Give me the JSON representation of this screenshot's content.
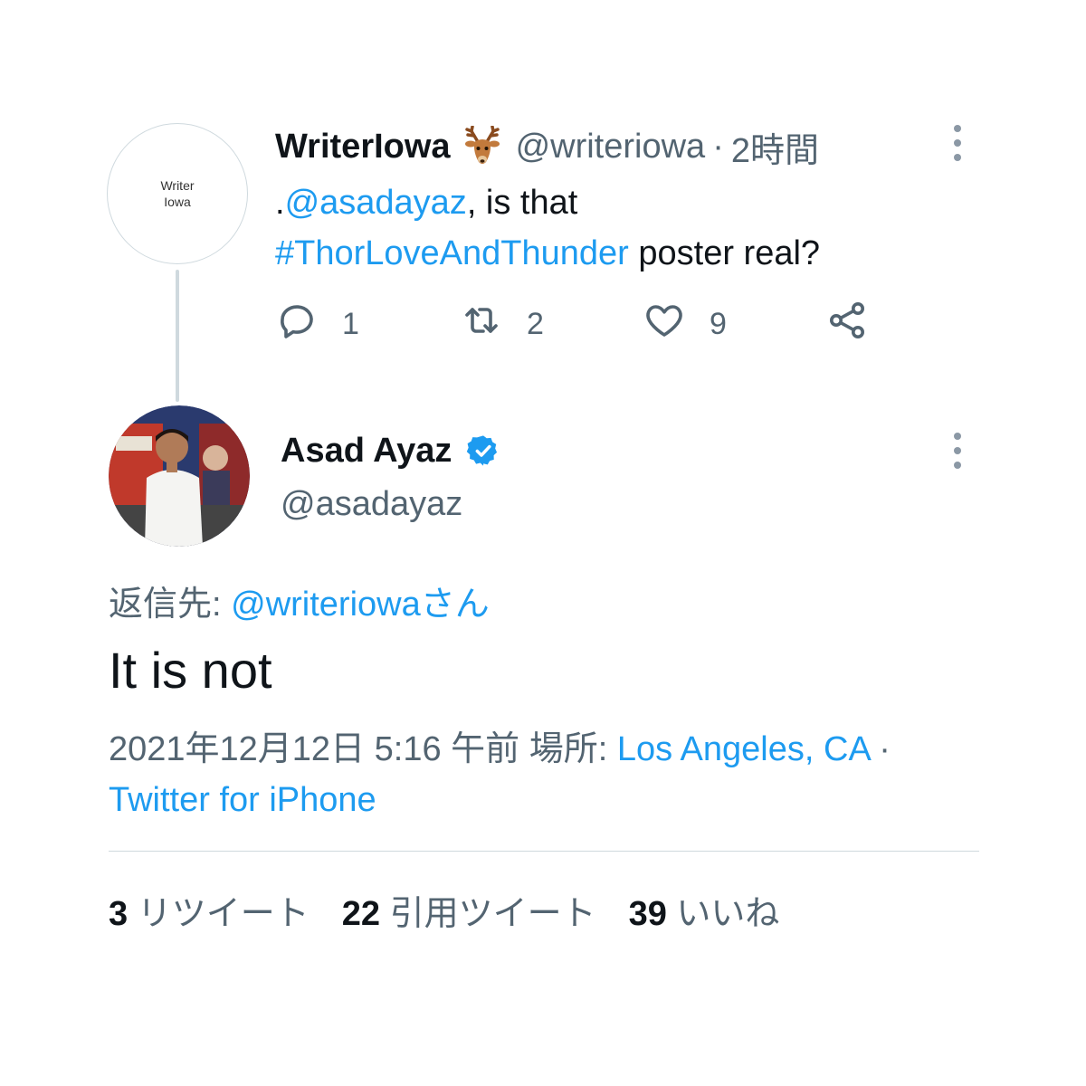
{
  "parent_tweet": {
    "avatar_text_line1": "Writer",
    "avatar_text_line2": "Iowa",
    "display_name": "WriterIowa",
    "name_emoji": "deer-emoji",
    "handle": "@writeriowa",
    "separator": "·",
    "time": "2時間",
    "text_prefix": ".",
    "mention": "@asadayaz",
    "text_mid": ", is that",
    "hashtag": "#ThorLoveAndThunder",
    "text_suffix": " poster real?",
    "actions": {
      "reply_count": "1",
      "retweet_count": "2",
      "like_count": "9"
    }
  },
  "reply_tweet": {
    "display_name": "Asad Ayaz",
    "handle": "@asadayaz",
    "replying_to_label": "返信先: ",
    "replying_to_handle": "@writeriowaさん",
    "text": "It is not",
    "date": "2021年12月12日 5:16 午前 ",
    "location_label": "場所: ",
    "location": "Los Angeles, CA",
    "separator": " ·",
    "source": "Twitter for iPhone",
    "stats": [
      {
        "count": "3",
        "label": "リツイート"
      },
      {
        "count": "22",
        "label": "引用ツイート"
      },
      {
        "count": "39",
        "label": "いいね"
      }
    ]
  },
  "colors": {
    "accent": "#1d9bf0",
    "secondary_text": "#536471",
    "primary_text": "#0f1419",
    "divider": "#cfd9de"
  }
}
